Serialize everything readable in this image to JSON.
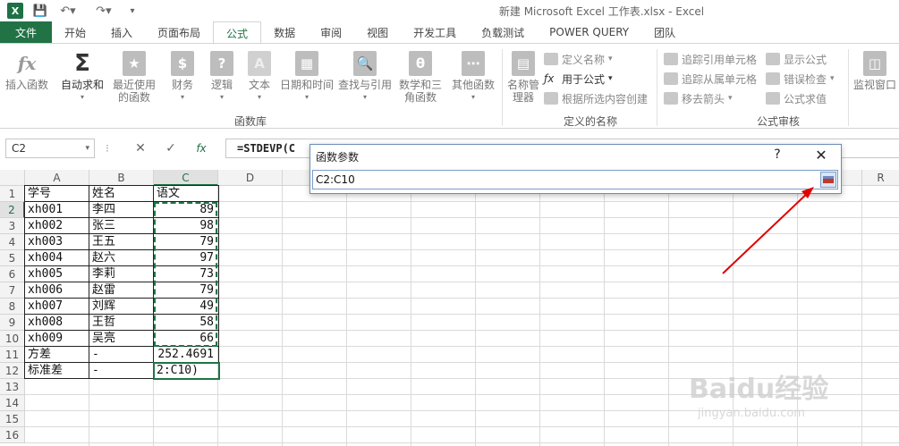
{
  "window": {
    "title": "新建 Microsoft Excel 工作表.xlsx - Excel",
    "logo": "X"
  },
  "qat": {
    "save_icon": "save-icon",
    "undo_icon": "undo-icon",
    "redo_icon": "redo-icon"
  },
  "tabs": [
    "文件",
    "开始",
    "插入",
    "页面布局",
    "公式",
    "数据",
    "审阅",
    "视图",
    "开发工具",
    "负载测试",
    "POWER QUERY",
    "团队"
  ],
  "active_tab": "公式",
  "ribbon": {
    "insert_function": "插入函数",
    "autosum": "自动求和",
    "recent": "最近使用的函数",
    "financial": "财务",
    "logical": "逻辑",
    "text": "文本",
    "datetime": "日期和时间",
    "lookup": "查找与引用",
    "math": "数学和三角函数",
    "more": "其他函数",
    "group_library": "函数库",
    "name_manager": "名称管理器",
    "define_name": "定义名称",
    "use_in_formula": "用于公式",
    "create_from_selection": "根据所选内容创建",
    "group_names": "定义的名称",
    "trace_precedents": "追踪引用单元格",
    "trace_dependents": "追踪从属单元格",
    "remove_arrows": "移去箭头",
    "show_formulas": "显示公式",
    "error_checking": "错误检查",
    "evaluate_formula": "公式求值",
    "group_auditing": "公式审核",
    "watch_window": "监视窗口"
  },
  "formula_bar": {
    "name_box": "C2",
    "cancel": "✕",
    "enter": "✓",
    "fx": "fx",
    "formula": "=STDEVP(C"
  },
  "columns": [
    "A",
    "B",
    "C",
    "D",
    "E",
    "F",
    "G",
    "H",
    "I",
    "J",
    "K",
    "L",
    "M",
    "N",
    "O",
    "P",
    "Q",
    "R"
  ],
  "rows": [
    "1",
    "2",
    "3",
    "4",
    "5",
    "6",
    "7",
    "8",
    "9",
    "10",
    "11",
    "12",
    "13",
    "14",
    "15",
    "16"
  ],
  "cells": [
    [
      "学号",
      "姓名",
      "语文"
    ],
    [
      "xh001",
      "李四",
      "89"
    ],
    [
      "xh002",
      "张三",
      "98"
    ],
    [
      "xh003",
      "王五",
      "79"
    ],
    [
      "xh004",
      "赵六",
      "97"
    ],
    [
      "xh005",
      "李莉",
      "73"
    ],
    [
      "xh006",
      "赵雷",
      "79"
    ],
    [
      "xh007",
      "刘辉",
      "49"
    ],
    [
      "xh008",
      "王哲",
      "58"
    ],
    [
      "xh009",
      "吴亮",
      "66"
    ],
    [
      "方差",
      "-",
      "252.4691"
    ],
    [
      "标准差",
      "-",
      "2:C10)"
    ]
  ],
  "dialog": {
    "title": "函数参数",
    "help": "?",
    "close": "✕",
    "value": "C2:C10"
  },
  "watermark": {
    "brand": "Baidu经验",
    "url": "jingyan.baidu.com"
  },
  "colors": {
    "accent": "#217346",
    "arrow": "#e00000"
  }
}
